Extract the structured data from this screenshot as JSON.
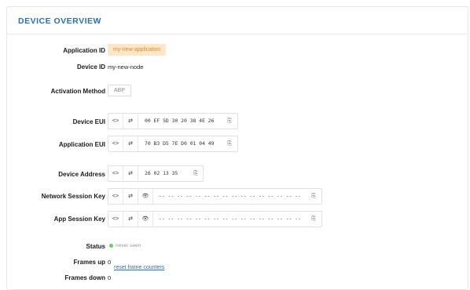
{
  "panel": {
    "title": "DEVICE OVERVIEW"
  },
  "fields": {
    "application_id": {
      "label": "Application ID",
      "value": "my-new-application"
    },
    "device_id": {
      "label": "Device ID",
      "value": "my-new-node"
    },
    "activation_method": {
      "label": "Activation Method",
      "value": "ABP"
    },
    "device_eui": {
      "label": "Device EUI",
      "value": "00 EF 5D 30 20 38 4E 26"
    },
    "application_eui": {
      "label": "Application EUI",
      "value": "70 B3 D5 7E D0 01 04 49"
    },
    "device_address": {
      "label": "Device Address",
      "value": "26 02 13 35"
    },
    "network_session_key": {
      "label": "Network Session Key",
      "value": "-- -- -- -- -- -- -- -- -- -- -- -- -- -- -- --"
    },
    "app_session_key": {
      "label": "App Session Key",
      "value": "-- -- -- -- -- -- -- -- -- -- -- -- -- -- -- --"
    },
    "status": {
      "label": "Status",
      "value": "never seen",
      "dot_color": "#5fd35f"
    },
    "frames_up": {
      "label": "Frames up",
      "value": "0",
      "link": "reset frame counters"
    },
    "frames_down": {
      "label": "Frames down",
      "value": "0"
    }
  },
  "key_controls": {
    "toggle_format_glyph": "<>",
    "byte_order_glyph": "⇄",
    "show_glyph": "👁",
    "copy_glyph": "⎘"
  },
  "colors": {
    "accent": "#2c6fb6",
    "app_id_badge_bg": "#fde7c8",
    "app_id_badge_text": "#d98a2b"
  }
}
